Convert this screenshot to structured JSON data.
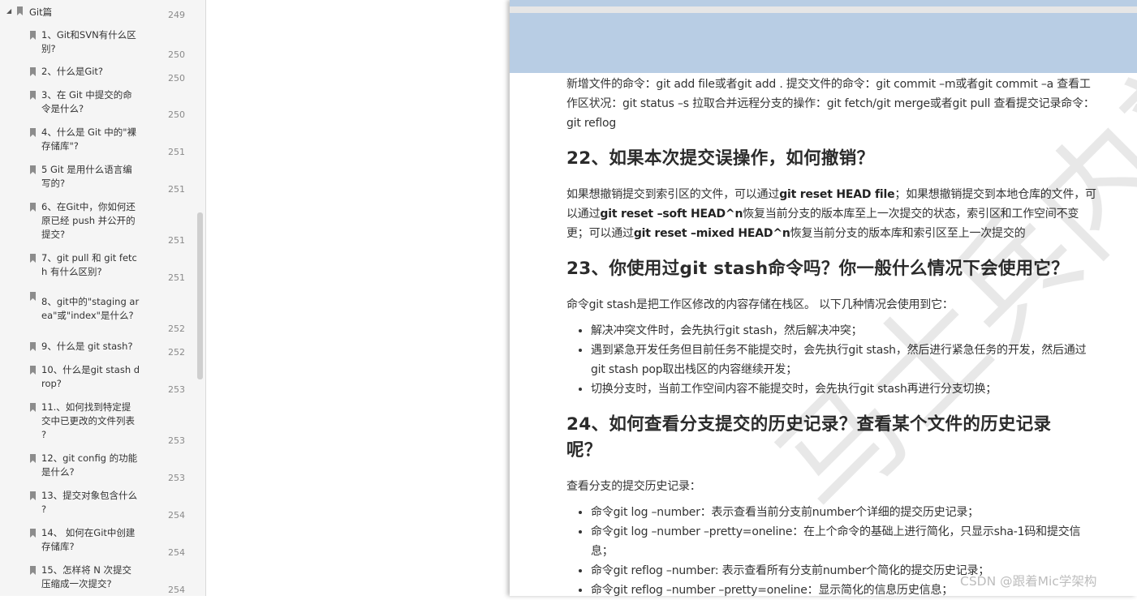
{
  "sidebar": {
    "root": {
      "title": "Git篇",
      "page": "249"
    },
    "items": [
      {
        "line1": "1、Git和SVN有什么区",
        "line2": "别?",
        "page": "250"
      },
      {
        "line1": "2、什么是Git?",
        "line2": "",
        "page": "250"
      },
      {
        "line1": "3、在 Git 中提交的命",
        "line2": "令是什么?",
        "page": "250"
      },
      {
        "line1": "4、什么是 Git 中的\"裸",
        "line2": "存储库\"?",
        "page": "251"
      },
      {
        "line1": "5 Git 是用什么语言编",
        "line2": "写的?",
        "page": "251"
      },
      {
        "line1": "6、在Git中，你如何还",
        "line2": "原已经 push 并公开的",
        "line3": "提交?",
        "page": "251"
      },
      {
        "line1": "7、git pull 和 git fetc",
        "line2": "h 有什么区别?",
        "page": "251"
      },
      {
        "line1": "8、git中的\"staging ar",
        "line2": "ea\"或\"index\"是什么?",
        "page": "252"
      },
      {
        "line1": "9、什么是 git stash?",
        "line2": "",
        "page": "252"
      },
      {
        "line1": "10、什么是git stash d",
        "line2": "rop?",
        "page": "253"
      },
      {
        "line1": "11.、如何找到特定提",
        "line2": "交中已更改的文件列表",
        "line3": "?",
        "page": "253"
      },
      {
        "line1": "12、git config 的功能",
        "line2": "是什么?",
        "page": "253"
      },
      {
        "line1": "13、提交对象包含什么",
        "line2": "?",
        "page": "254"
      },
      {
        "line1": "14、 如何在Git中创建",
        "line2": "存储库?",
        "page": "254"
      },
      {
        "line1": "15、怎样将 N 次提交",
        "line2": "压缩成一次提交?",
        "page": "254"
      }
    ]
  },
  "doc": {
    "intro": "新增文件的命令：git add file或者git add . 提交文件的命令：git commit –m或者git commit –a 查看工作区状况：git status –s 拉取合并远程分支的操作：git fetch/git merge或者git pull 查看提交记录命令：git reflog",
    "h22": "22、如果本次提交误操作，如何撤销？",
    "p22_a": "如果想撤销提交到索引区的文件，可以通过",
    "p22_b": "git reset HEAD file",
    "p22_c": "；如果想撤销提交到本地仓库的文件，可以通过",
    "p22_d": "git reset –soft HEAD^n",
    "p22_e": "恢复当前分支的版本库至上一次提交的状态，索引区和工作空间不变更；可以通过",
    "p22_f": "git reset –mixed HEAD^n",
    "p22_g": "恢复当前分支的版本库和索引区至上一次提交的",
    "h23": "23、你使用过git stash命令吗？你一般什么情况下会使用它？",
    "p23": "命令git stash是把工作区修改的内容存储在栈区。 以下几种情况会使用到它：",
    "list23": [
      "解决冲突文件时，会先执行git stash，然后解决冲突；",
      "遇到紧急开发任务但目前任务不能提交时，会先执行git stash，然后进行紧急任务的开发，然后通过git stash pop取出栈区的内容继续开发；",
      "切换分支时，当前工作空间内容不能提交时，会先执行git stash再进行分支切换；"
    ],
    "h24_l1": "24、如何查看分支提交的历史记录？查看某个文件的历史记录",
    "h24_l2": "呢？",
    "p24": "查看分支的提交历史记录：",
    "list24": [
      "命令git log –number：表示查看当前分支前number个详细的提交历史记录；",
      "命令git log –number –pretty=oneline：在上个命令的基础上进行简化，只显示sha-1码和提交信息；",
      "命令git reflog –number: 表示查看所有分支前number个简化的提交历史记录；",
      "命令git reflog –number –pretty=oneline：显示简化的信息历史信息；"
    ]
  },
  "watermark": "马士兵内部资料",
  "csdn_mark": "CSDN @跟着Mic学架构"
}
